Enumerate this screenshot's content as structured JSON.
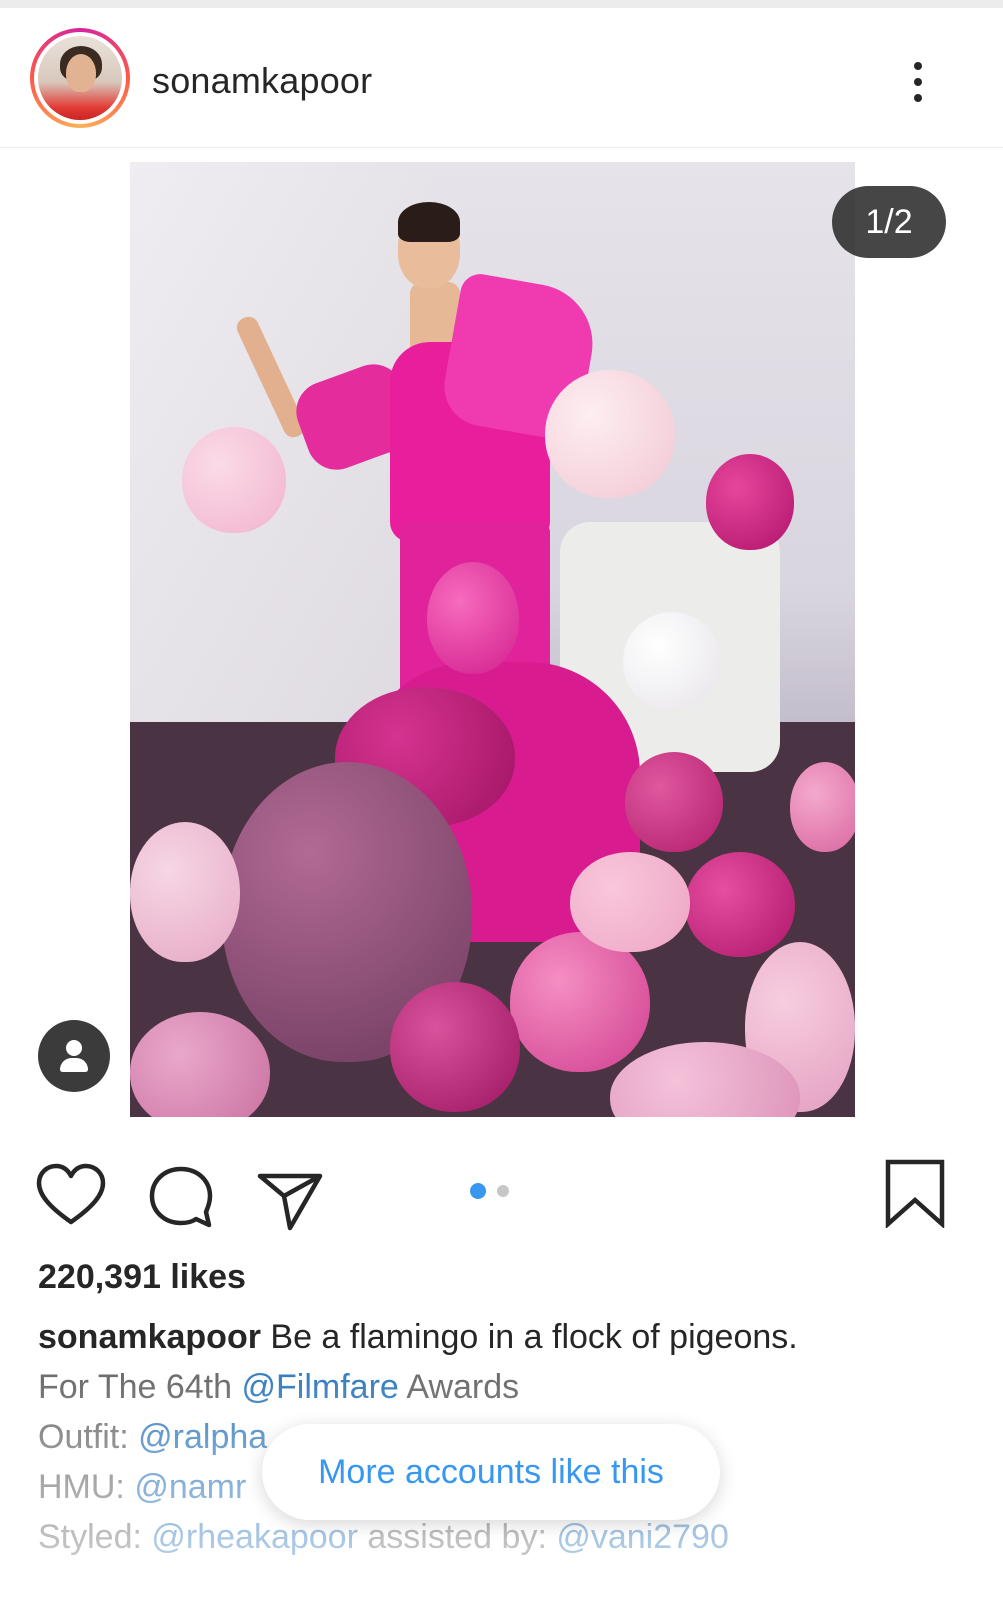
{
  "post": {
    "username": "sonamkapoor",
    "media_counter": "1/2",
    "likes": "220,391 likes",
    "carousel": {
      "total": 2,
      "active_index": 0
    }
  },
  "caption": {
    "username": "sonamkapoor",
    "line1_text": " Be a flamingo in a flock of pigeons.",
    "line2_prefix": "For The 64th ",
    "line2_mention": "@Filmfare",
    "line2_suffix": " Awards",
    "line3_label": "Outfit: ",
    "line3_mention": "@ralpha",
    "line4_label": "HMU: ",
    "line4_mention": "@namr",
    "line5_label": "Styled: ",
    "line5_mention1": "@rheakapoor",
    "line5_middle": " assisted by: ",
    "line5_mention2": "@vani2790"
  },
  "suggestion": {
    "more_accounts_label": "More accounts like this"
  },
  "icons": {
    "header": [
      "more-vertical-icon"
    ],
    "actions": [
      "heart-icon",
      "comment-icon",
      "share-icon",
      "bookmark-icon"
    ],
    "overlay": [
      "user-tag-icon"
    ]
  },
  "colors": {
    "text": "#262626",
    "mention": "#3a7fbf",
    "active_dot": "#3897f0",
    "inactive_dot": "#c7c7c7",
    "counter_bg": "#262626",
    "link_blue": "#3897f0"
  }
}
